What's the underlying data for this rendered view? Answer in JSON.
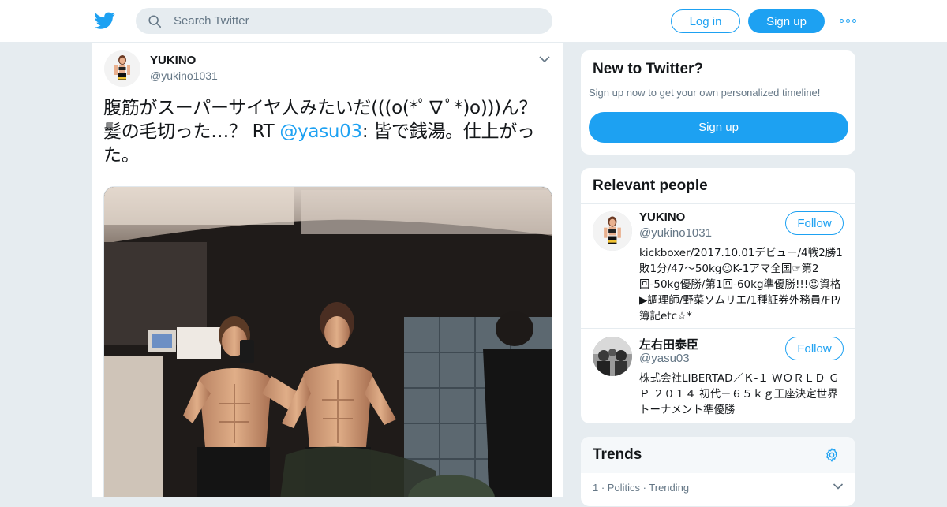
{
  "header": {
    "logo_icon": "twitter-bird-icon",
    "search_placeholder": "Search Twitter",
    "login_label": "Log in",
    "signup_label": "Sign up",
    "more_icon": "more-dots-icon"
  },
  "tweet": {
    "name": "YUKINO",
    "handle": "@yukino1031",
    "text_before": "腹筋がスーパーサイヤ人みたいだ(((o(*ﾟ∇ﾟ*)o)))ん？髪の毛切った…？ RT ",
    "mention": "@yasu03",
    "text_after": ": 皆で銭湯。仕上がった。",
    "media_alt_icon": "photo"
  },
  "new_to_twitter": {
    "title": "New to Twitter?",
    "subtitle": "Sign up now to get your own personalized timeline!",
    "signup_label": "Sign up"
  },
  "relevant_people": {
    "title": "Relevant people",
    "people": [
      {
        "name": "YUKINO",
        "handle": "@yukino1031",
        "follow_label": "Follow",
        "bio": "kickboxer/2017.10.01デビュー/4戦2勝1敗1分/47〜50kg☺K-1アマ全国☞第2回-50kg優勝/第1回-60kg準優勝!!!☺資格▶調理師/野菜ソムリエ/1種証券外務員/FP/簿記etc☆*"
      },
      {
        "name": "左右田泰臣",
        "handle": "@yasu03",
        "follow_label": "Follow",
        "bio": "株式会社LIBERTAD／Ｋ-１ ＷＯＲＬＤ ＧＰ ２０１４ 初代－６５ｋｇ王座決定世界トーナメント準優勝"
      }
    ]
  },
  "trends": {
    "title": "Trends",
    "settings_icon": "gear-icon",
    "first_row": "1 · Politics · Trending"
  },
  "colors": {
    "accent": "#1da1f2",
    "muted": "#657786",
    "background": "#e6ecf0"
  }
}
